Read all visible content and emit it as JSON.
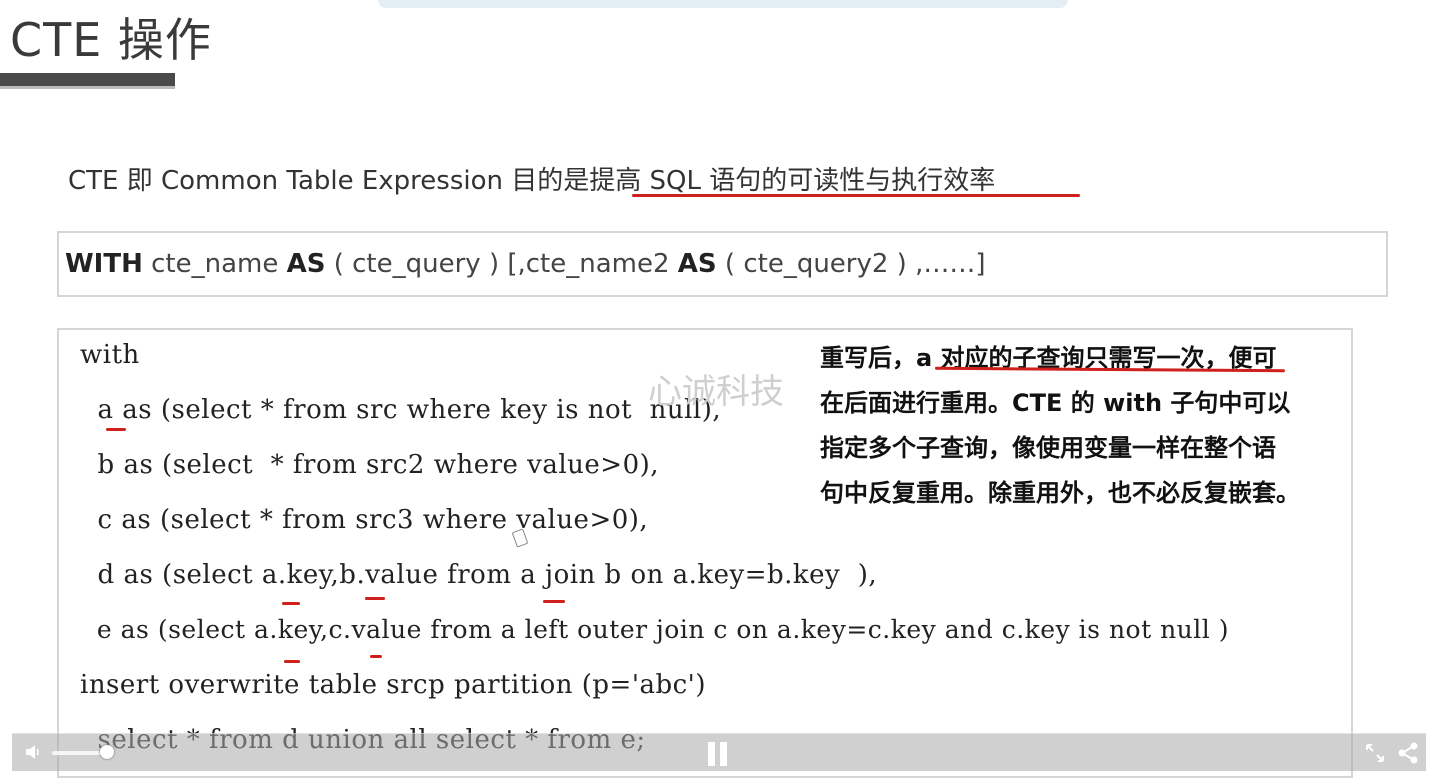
{
  "slide": {
    "title": "CTE 操作",
    "intro": "CTE 即 Common Table Expression 目的是提高 SQL 语句的可读性与执行效率",
    "syntax": {
      "kw_with": "WITH",
      "part1": " cte_name ",
      "kw_as1": "AS",
      "part2": " ( cte_query ) [,cte_name2 ",
      "kw_as2": "AS",
      "part3": " ( cte_query2 ) ,……]"
    },
    "code_lines": [
      "with",
      "  a as (select * from src where key is not  null),",
      "  b as (select  * from src2 where value>0),",
      "  c as (select * from src3 where value>0),",
      "  d as (select a.key,b.value from a join b on a.key=b.key  ),",
      "  e as (select a.key,c.value from a left outer join c on a.key=c.key and c.key is not null )",
      "insert overwrite table srcp partition (p='abc')",
      "  select * from d union all select * from e;"
    ],
    "watermark": "心诚科技",
    "annotation_lines": [
      "重写后，a 对应的子查询只需写一次，便可",
      "在后面进行重用。CTE 的 with 子句中可以",
      "指定多个子查询，像使用变量一样在整个语",
      "句中反复重用。除重用外，也不必反复嵌套。"
    ]
  },
  "player": {
    "volume": 0.8,
    "state": "playing"
  },
  "colors": {
    "underline_red": "#d0201c",
    "code_null_green": "#66aa66",
    "code_string": "#a0524a"
  },
  "icons": [
    "volume-icon",
    "pause-icon",
    "fullscreen-icon",
    "share-icon"
  ]
}
